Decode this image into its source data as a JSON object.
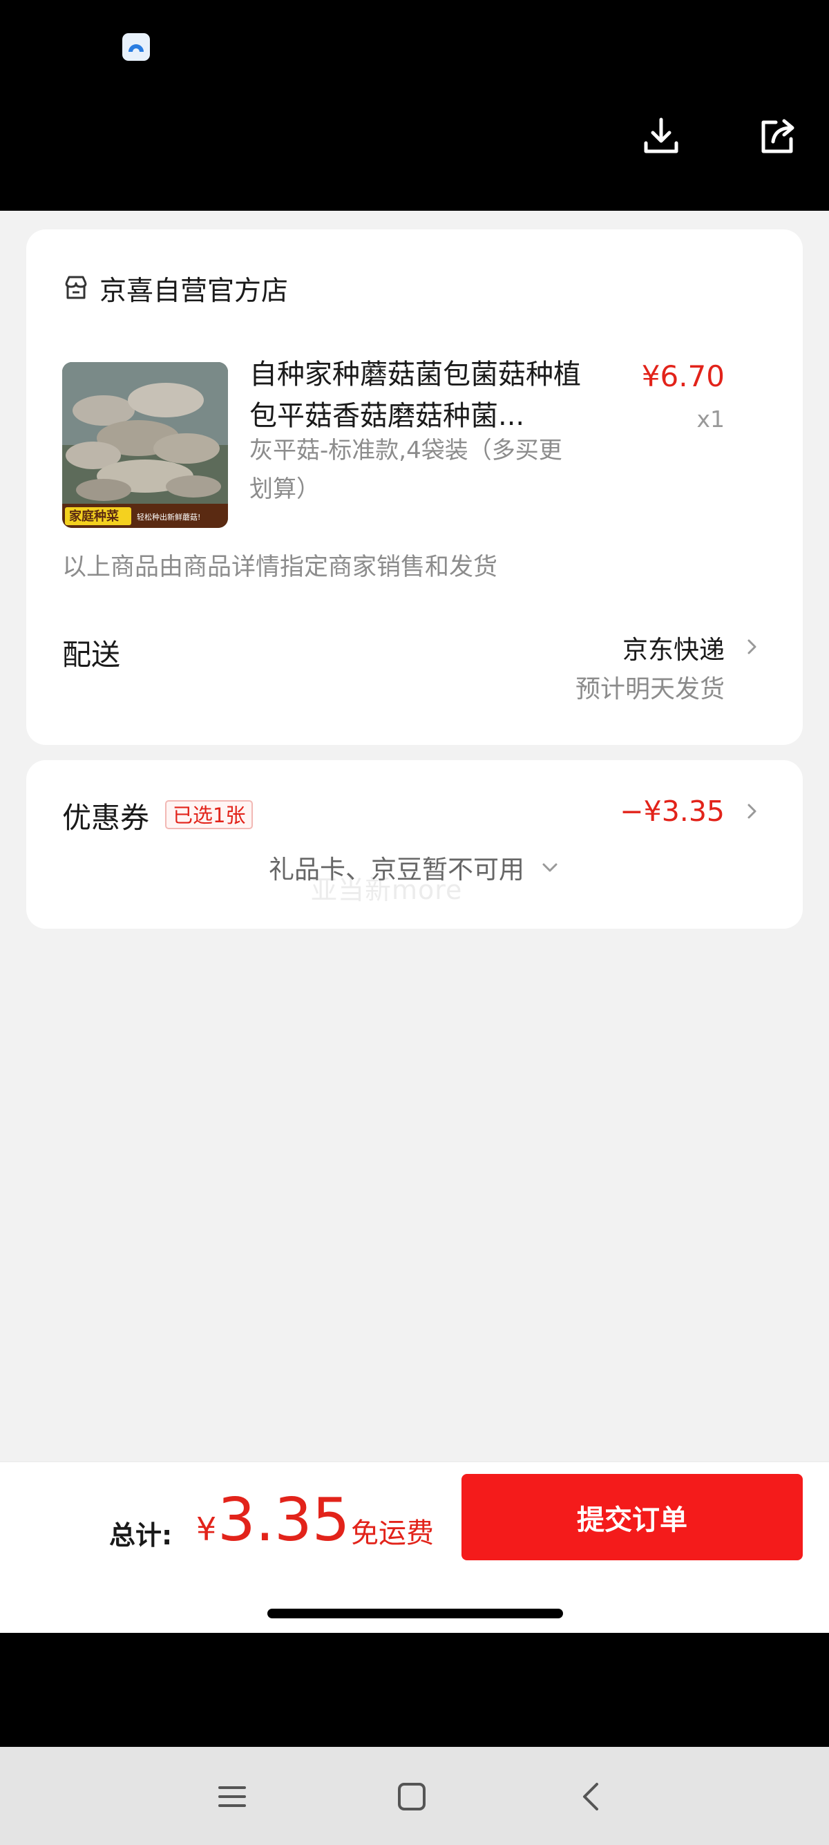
{
  "header": {
    "app_icon": "app-badge-icon",
    "download_icon": "download-icon",
    "share_icon": "share-icon"
  },
  "store": {
    "icon": "store-icon",
    "name": "京喜自营官方店"
  },
  "product": {
    "title": "自种家种蘑菇菌包菌菇种植包平菇香菇磨菇种菌...",
    "variant": "灰平菇-标准款,4袋装（多买更划算）",
    "price": "¥6.70",
    "quantity": "x1",
    "image_caption": "家庭种菜",
    "image_subcaption": "轻松种出新鲜蘑菇!"
  },
  "seller_note": "以上商品由商品详情指定商家销售和发货",
  "shipping": {
    "label": "配送",
    "method": "京东快递",
    "eta": "预计明天发货"
  },
  "coupon": {
    "label": "优惠券",
    "badge": "已选1张",
    "amount": "−¥3.35",
    "gift_card_text": "礼品卡、京豆暂不可用",
    "watermark": "亚当新more"
  },
  "footer": {
    "total_label": "总计:",
    "currency": "¥",
    "total": "3.35",
    "free_shipping": "免运费",
    "submit_label": "提交订单"
  },
  "system_nav": {
    "menu_icon": "menu-icon",
    "home_icon": "home-square-icon",
    "back_icon": "back-chevron-icon"
  },
  "colors": {
    "accent_red": "#e2231a",
    "button_red": "#f41b1b",
    "page_bg": "#f2f2f2"
  }
}
